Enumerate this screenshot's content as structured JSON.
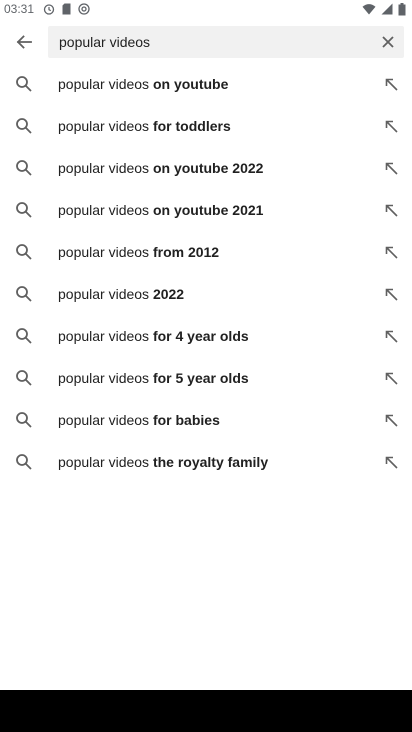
{
  "status_bar": {
    "time": "03:31"
  },
  "search": {
    "query": "popular videos"
  },
  "suggestions": [
    {
      "prefix": "popular videos",
      "suffix": " on youtube"
    },
    {
      "prefix": "popular videos",
      "suffix": " for toddlers"
    },
    {
      "prefix": "popular videos",
      "suffix": " on youtube 2022"
    },
    {
      "prefix": "popular videos",
      "suffix": " on youtube 2021"
    },
    {
      "prefix": "popular videos",
      "suffix": " from 2012"
    },
    {
      "prefix": "popular videos",
      "suffix": " 2022"
    },
    {
      "prefix": "popular videos",
      "suffix": " for 4 year olds"
    },
    {
      "prefix": "popular videos",
      "suffix": " for 5 year olds"
    },
    {
      "prefix": "popular videos",
      "suffix": " for babies"
    },
    {
      "prefix": "popular videos",
      "suffix": " the royalty family"
    }
  ],
  "colors": {
    "search_field_bg": "#f1f1f1",
    "icon": "#606060",
    "nav_bar": "#000000"
  },
  "icons": {
    "back": "arrow-back-icon",
    "clear": "close-icon",
    "suggestion": "search-icon",
    "fill": "arrow-up-left-icon"
  }
}
